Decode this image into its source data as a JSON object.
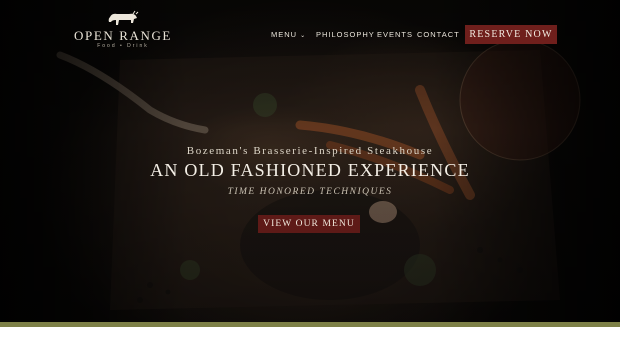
{
  "brand": {
    "name": "OPEN RANGE",
    "sub": "Food • Drink",
    "icon": "bull-icon"
  },
  "nav": {
    "items": [
      {
        "label": "MENU",
        "has_dropdown": true
      },
      {
        "label": "PHILOSOPHY"
      },
      {
        "label": "EVENTS"
      },
      {
        "label": "CONTACT"
      }
    ],
    "reserve_label": "RESERVE NOW"
  },
  "hero": {
    "tagline": "Bozeman's Brasserie-Inspired Steakhouse",
    "headline": "AN OLD FASHIONED EXPERIENCE",
    "subheadline": "TIME HONORED TECHNIQUES",
    "cta_label": "VIEW OUR MENU"
  },
  "colors": {
    "accent_red": "#6f1f1c",
    "olive_band": "#7d8047",
    "text_light": "#f4efe6"
  }
}
